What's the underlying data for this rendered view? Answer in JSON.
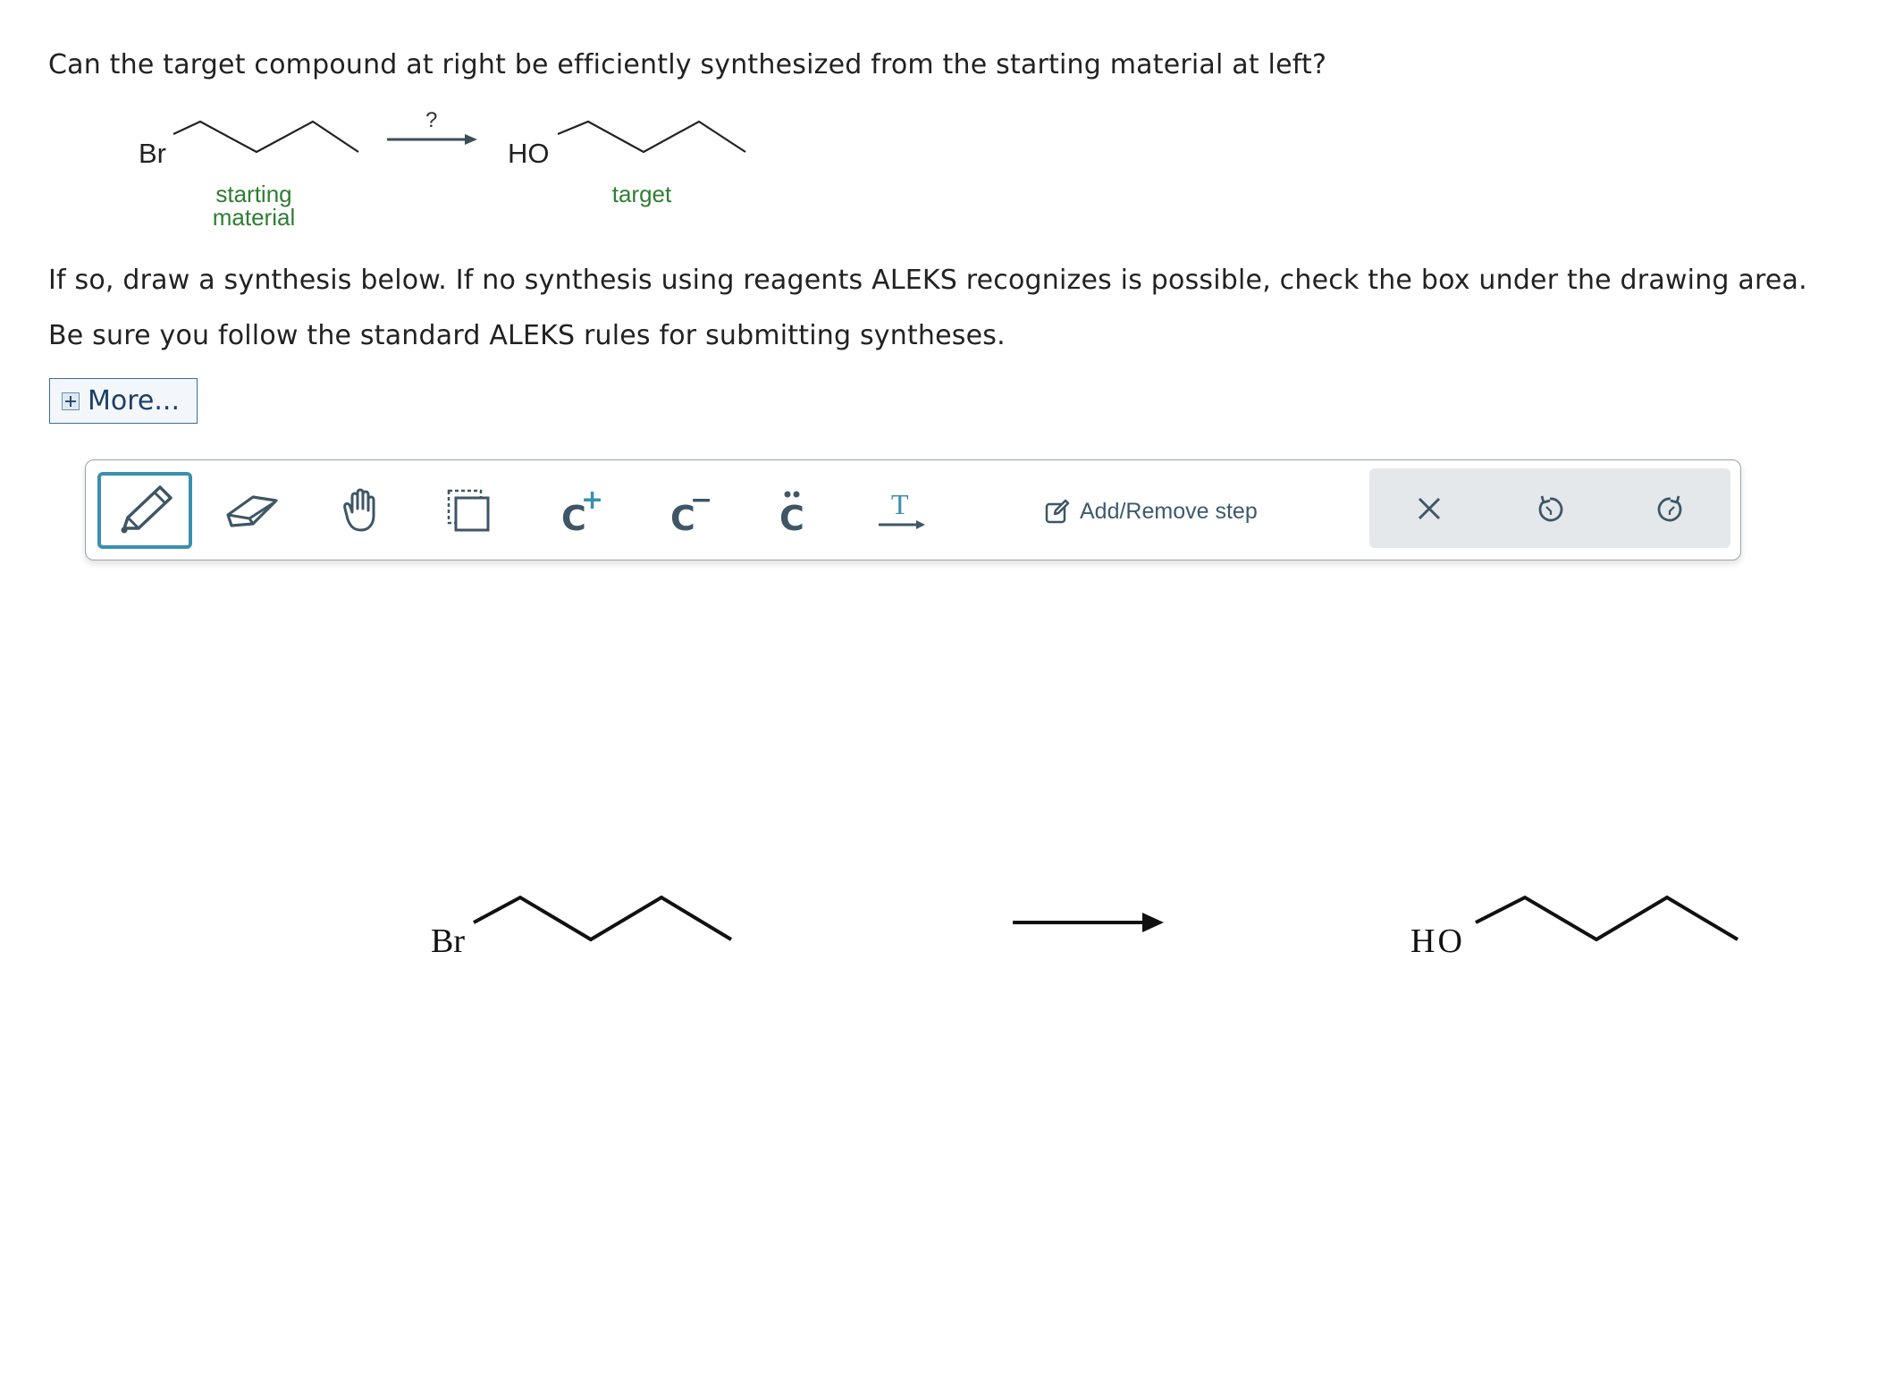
{
  "question": {
    "line1": "Can the target compound at right be efficiently synthesized from the starting material at left?",
    "line2": "If so, draw a synthesis below. If no synthesis using reagents ALEKS recognizes is possible, check the box under the drawing area.",
    "line3": "Be sure you follow the standard ALEKS rules for submitting syntheses."
  },
  "reaction_preview": {
    "start_atom": "Br",
    "arrow_label": "?",
    "target_atom": "HO",
    "start_caption_1": "starting",
    "start_caption_2": "material",
    "target_caption": "target",
    "caption_color": "#2e7d32"
  },
  "more_button": {
    "label": "More..."
  },
  "toolbar": {
    "tools": [
      {
        "name": "pencil-tool",
        "icon": "pencil-icon",
        "active": true
      },
      {
        "name": "eraser-tool",
        "icon": "eraser-icon"
      },
      {
        "name": "hand-tool",
        "icon": "hand-icon"
      },
      {
        "name": "select-tool",
        "icon": "selection-box-icon"
      },
      {
        "name": "carbocation-tool",
        "icon": "carbocation-icon",
        "glyph": "C",
        "superscript": "+"
      },
      {
        "name": "carbanion-tool",
        "icon": "carbanion-icon",
        "glyph": "C",
        "superscript": "−"
      },
      {
        "name": "lone-pair-tool",
        "icon": "lone-pair-icon",
        "glyph": "C"
      },
      {
        "name": "reaction-text-tool",
        "icon": "reaction-text-icon",
        "glyph": "T"
      }
    ],
    "add_remove_step": "Add/Remove step",
    "right_actions": [
      "clear-icon",
      "undo-icon",
      "redo-icon"
    ],
    "accent_color": "#3b8fb0"
  },
  "drawing_area": {
    "start_atom": "Br",
    "target_atom": "HO"
  }
}
